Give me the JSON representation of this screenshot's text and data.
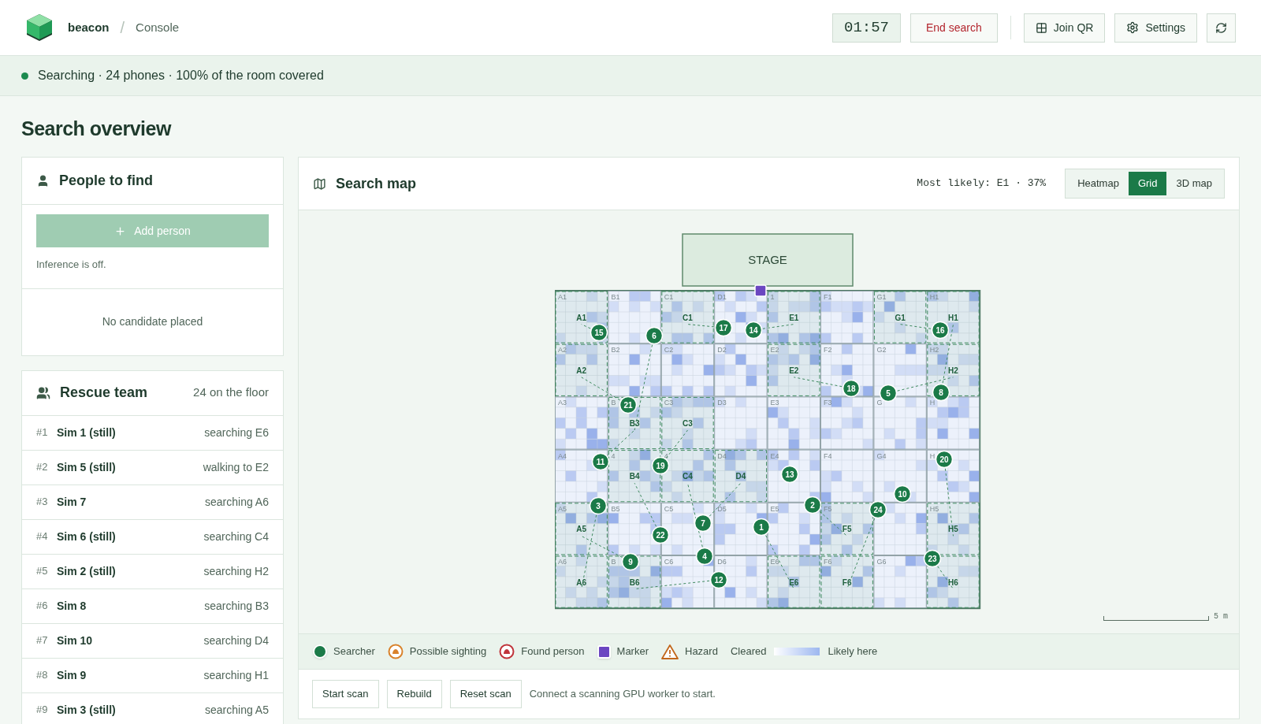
{
  "header": {
    "brand": "beacon",
    "separator": "/",
    "section": "Console",
    "timer": "01:57",
    "end_button": "End search",
    "join_button": "Join QR",
    "settings_button": "Settings"
  },
  "status": {
    "text": "Searching · 24 phones · 100% of the room covered",
    "active": true
  },
  "page_title": "Search overview",
  "people_card": {
    "title": "People to find",
    "add_button": "Add person",
    "add_disabled": true,
    "note": "Inference is off.",
    "empty": "No candidate placed"
  },
  "team_card": {
    "title": "Rescue team",
    "count": "24 on the floor",
    "rows": [
      {
        "rank": "#1",
        "name": "Sim 1 (still)",
        "task": "searching E6"
      },
      {
        "rank": "#2",
        "name": "Sim 5 (still)",
        "task": "walking to E2"
      },
      {
        "rank": "#3",
        "name": "Sim 7",
        "task": "searching A6"
      },
      {
        "rank": "#4",
        "name": "Sim 6 (still)",
        "task": "searching C4"
      },
      {
        "rank": "#5",
        "name": "Sim 2 (still)",
        "task": "searching H2"
      },
      {
        "rank": "#6",
        "name": "Sim 8",
        "task": "searching B3"
      },
      {
        "rank": "#7",
        "name": "Sim 10",
        "task": "searching D4"
      },
      {
        "rank": "#8",
        "name": "Sim 9",
        "task": "searching H1"
      },
      {
        "rank": "#9",
        "name": "Sim 3 (still)",
        "task": "searching A5"
      }
    ]
  },
  "map_panel": {
    "title": "Search map",
    "most_likely": "Most likely: E1 · 37%",
    "views": [
      {
        "label": "Heatmap",
        "selected": false
      },
      {
        "label": "Grid",
        "selected": true
      },
      {
        "label": "3D map",
        "selected": false
      }
    ],
    "stage": "STAGE",
    "scale": "5 m",
    "zones": [
      {
        "corner": "A1",
        "assigned": true,
        "name": "A1"
      },
      {
        "corner": "B1",
        "assigned": false
      },
      {
        "corner": "C1",
        "assigned": true,
        "name": "C1"
      },
      {
        "corner": "D1",
        "assigned": false
      },
      {
        "corner": "1",
        "assigned": true,
        "name": "E1"
      },
      {
        "corner": "F1",
        "assigned": false
      },
      {
        "corner": "G1",
        "assigned": true,
        "name": "G1"
      },
      {
        "corner": "H1",
        "assigned": true,
        "name": "H1"
      },
      {
        "corner": "A2",
        "assigned": true,
        "name": "A2"
      },
      {
        "corner": "B2",
        "assigned": false
      },
      {
        "corner": "C2",
        "assigned": false
      },
      {
        "corner": "D2",
        "assigned": false
      },
      {
        "corner": "E2",
        "assigned": true,
        "name": "E2"
      },
      {
        "corner": "F2",
        "assigned": false
      },
      {
        "corner": "G2",
        "assigned": false
      },
      {
        "corner": "H2",
        "assigned": true,
        "name": "H2"
      },
      {
        "corner": "A3",
        "assigned": false
      },
      {
        "corner": "B",
        "assigned": true,
        "name": "B3"
      },
      {
        "corner": "C3",
        "assigned": true,
        "name": "C3"
      },
      {
        "corner": "D3",
        "assigned": false
      },
      {
        "corner": "E3",
        "assigned": false
      },
      {
        "corner": "F3",
        "assigned": false
      },
      {
        "corner": "G",
        "assigned": false
      },
      {
        "corner": "H",
        "assigned": false
      },
      {
        "corner": "A4",
        "assigned": false
      },
      {
        "corner": "4",
        "assigned": true,
        "name": "B4"
      },
      {
        "corner": "4",
        "assigned": true,
        "name": "C4"
      },
      {
        "corner": "D4",
        "assigned": true,
        "name": "D4"
      },
      {
        "corner": "E4",
        "assigned": false
      },
      {
        "corner": "F4",
        "assigned": false
      },
      {
        "corner": "G4",
        "assigned": false
      },
      {
        "corner": "H",
        "assigned": false
      },
      {
        "corner": "A5",
        "assigned": true,
        "name": "A5"
      },
      {
        "corner": "B5",
        "assigned": false
      },
      {
        "corner": "C5",
        "assigned": false
      },
      {
        "corner": "D5",
        "assigned": false
      },
      {
        "corner": "E5",
        "assigned": false
      },
      {
        "corner": "F5",
        "assigned": true,
        "name": "F5"
      },
      {
        "assigned": false
      },
      {
        "corner": "H5",
        "assigned": true,
        "name": "H5"
      },
      {
        "corner": "A6",
        "assigned": true,
        "name": "A6"
      },
      {
        "corner": "B",
        "assigned": true,
        "name": "B6"
      },
      {
        "corner": "C6",
        "assigned": false
      },
      {
        "corner": "D6",
        "assigned": false
      },
      {
        "corner": "E6",
        "assigned": true,
        "name": "E6"
      },
      {
        "corner": "F6",
        "assigned": true,
        "name": "F6"
      },
      {
        "corner": "G6",
        "assigned": false
      },
      {
        "assigned": true,
        "name": "H6"
      }
    ],
    "searchers": [
      "15",
      "6",
      "17",
      "14",
      "16",
      "21",
      "18",
      "5",
      "8",
      "11",
      "19",
      "13",
      "20",
      "3",
      "2",
      "24",
      "10",
      "22",
      "7",
      "1",
      "9",
      "4",
      "23",
      "12"
    ],
    "legend": [
      {
        "kind": "searcher",
        "label": "Searcher"
      },
      {
        "kind": "sighting",
        "label": "Possible sighting"
      },
      {
        "kind": "found",
        "label": "Found person"
      },
      {
        "kind": "marker",
        "label": "Marker"
      },
      {
        "kind": "hazard",
        "label": "Hazard"
      },
      {
        "kind": "scale",
        "label": "Cleared",
        "end_label": "Likely here"
      }
    ],
    "actions": [
      "Start scan",
      "Rebuild",
      "Reset scan"
    ],
    "hint": "Connect a scanning GPU worker to start."
  }
}
